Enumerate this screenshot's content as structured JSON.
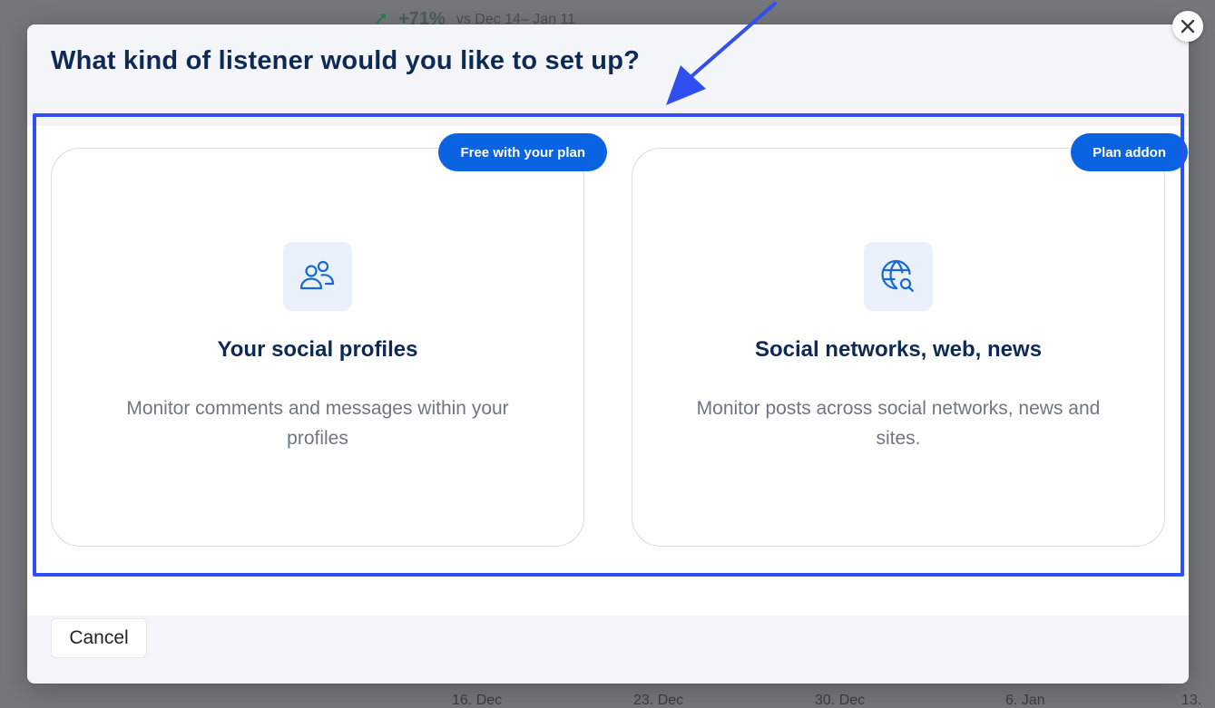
{
  "background": {
    "stat_value": "+71%",
    "stat_compare": "vs Dec 14– Jan 11",
    "axis_zero": "0",
    "axis_labels": [
      "16. Dec",
      "23. Dec",
      "30. Dec",
      "6. Jan",
      "13."
    ]
  },
  "modal": {
    "title": "What kind of listener would you like to set up?",
    "close_label": "Close",
    "options": [
      {
        "badge": "Free with your plan",
        "title": "Your social profiles",
        "description": "Monitor comments and messages within your profiles",
        "icon": "users-icon"
      },
      {
        "badge": "Plan addon",
        "title": "Social networks, web, news",
        "description": "Monitor posts across social networks, news and sites.",
        "icon": "globe-search-icon"
      }
    ],
    "cancel_label": "Cancel"
  },
  "colors": {
    "accent": "#0a63e0",
    "highlight": "#2f4ff0",
    "title": "#0d2a55",
    "description": "#6f7682"
  }
}
